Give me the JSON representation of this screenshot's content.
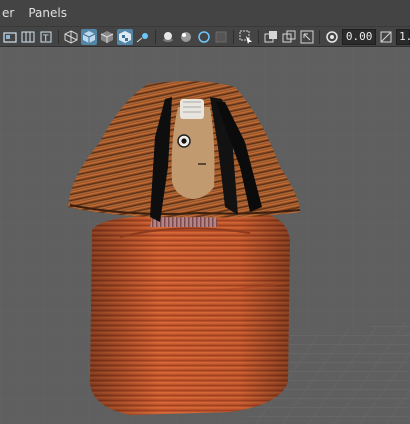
{
  "menubar": {
    "items": [
      "er",
      "Panels"
    ]
  },
  "toolbar": {
    "icons": [
      "camera-icon",
      "grid-icon",
      "bookmark-icon",
      "wireframe-cube-icon",
      "shaded-cube-icon",
      "textured-cube-icon",
      "checker-cube-icon",
      "light-icon",
      "sphere-shaded-icon",
      "sphere-lit-icon",
      "isolate-icon",
      "xray-icon",
      "select-icon",
      "snapshot-icon",
      "render-icon",
      "export-icon",
      "exposure-icon"
    ],
    "exposure_value": "0.00",
    "gamma_value": "1."
  },
  "colors": {
    "viewport_bg": "#5f5f5f",
    "accent": "#5285a6"
  }
}
